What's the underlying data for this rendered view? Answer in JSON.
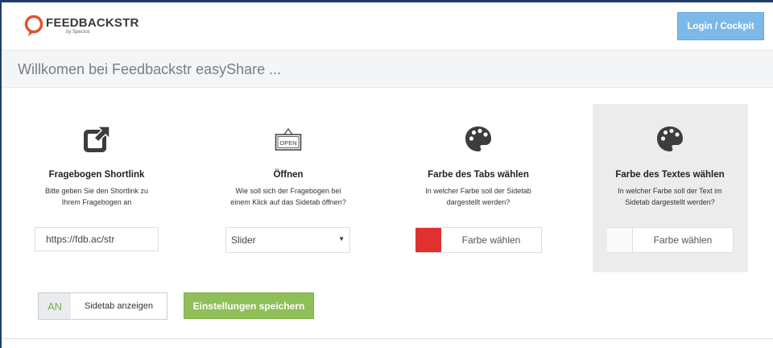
{
  "header": {
    "logo_name": "FEEDBACKSTR",
    "logo_sub": "by Spectos",
    "login_label": "Login / Cockpit"
  },
  "welcome": {
    "text": "Willkomen bei Feedbackstr easyShare ..."
  },
  "columns": [
    {
      "icon": "external-link-icon",
      "title": "Fragebogen Shortlink",
      "desc_line1": "Bitte geben Sie den Shortlink zu",
      "desc_line2": "Ihrem Fragebogen an",
      "input_value": "https://fdb.ac/str"
    },
    {
      "icon": "open-sign-icon",
      "icon_text": "OPEN",
      "title": "Öffnen",
      "desc_line1": "Wie soll sich der Fragebogen bei",
      "desc_line2": "einem Klick auf das Sidetab öffnen?",
      "select_value": "Slider",
      "select_arrow": "▼"
    },
    {
      "icon": "palette-icon",
      "title": "Farbe des Tabs wählen",
      "desc_line1": "In welcher Farbe soll der Sidetab",
      "desc_line2": "dargestellt werden?",
      "swatch_color": "#e03030",
      "button_label": "Farbe wählen"
    },
    {
      "icon": "palette-icon",
      "title": "Farbe des Textes wählen",
      "desc_line1": "In welcher Farbe soll der Text im",
      "desc_line2": "Sidetab dargestellt werden?",
      "swatch_color": "#ffffff",
      "button_label": "Farbe wählen"
    }
  ],
  "footer": {
    "toggle_state": "AN",
    "toggle_label": "Sidetab anzeigen",
    "save_label": "Einstellungen speichern"
  },
  "colors": {
    "accent_blue": "#7db9e8",
    "accent_green": "#8fbf58",
    "logo_orange": "#e2532d"
  }
}
